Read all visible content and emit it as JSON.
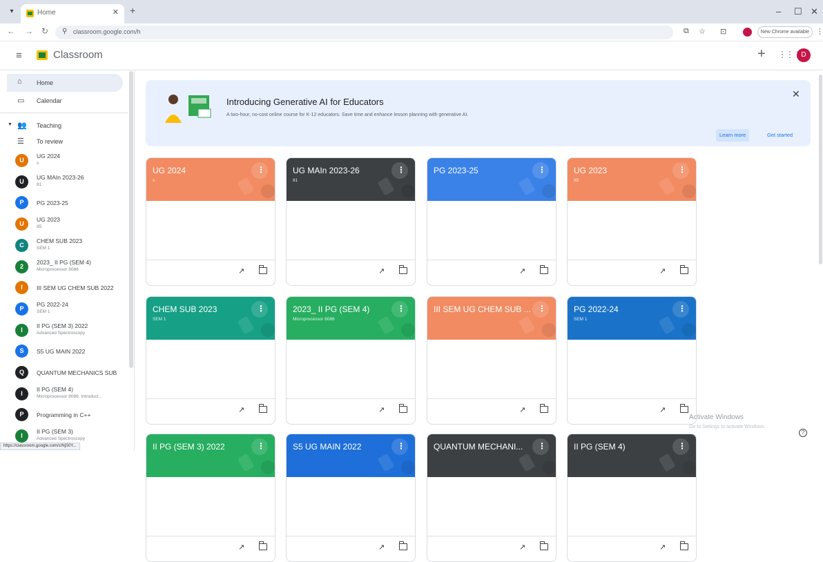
{
  "browser": {
    "tab_title": "Home",
    "url": "classroom.google.com/h",
    "new_chrome": "New Chrome available",
    "status_url": "https://classroom.google.com/c/NjS0Y..."
  },
  "app": {
    "name": "Classroom",
    "user_initial": "D"
  },
  "sidebar": {
    "home": "Home",
    "calendar": "Calendar",
    "teaching": "Teaching",
    "to_review": "To review",
    "courses": [
      {
        "initial": "U",
        "name": "UG 2024",
        "sub": "s",
        "color": "#e37400"
      },
      {
        "initial": "U",
        "name": "UG MAIn 2023-26",
        "sub": "81",
        "color": "#202124"
      },
      {
        "initial": "P",
        "name": "PG 2023-25",
        "sub": "",
        "color": "#1a73e8"
      },
      {
        "initial": "U",
        "name": "UG 2023",
        "sub": "85",
        "color": "#e37400"
      },
      {
        "initial": "C",
        "name": "CHEM SUB 2023",
        "sub": "SEM 1",
        "color": "#12837e"
      },
      {
        "initial": "2",
        "name": "2023_ II PG (SEM 4)",
        "sub": "Microprocessor 8086",
        "color": "#188038"
      },
      {
        "initial": "I",
        "name": "III SEM UG CHEM SUB 2022",
        "sub": "",
        "color": "#e37400"
      },
      {
        "initial": "P",
        "name": "PG 2022-24",
        "sub": "SEM 1",
        "color": "#1a73e8"
      },
      {
        "initial": "I",
        "name": "II PG (SEM 3) 2022",
        "sub": "Advanced Spectroscopy",
        "color": "#188038"
      },
      {
        "initial": "S",
        "name": "S5 UG MAIN 2022",
        "sub": "",
        "color": "#1a73e8"
      },
      {
        "initial": "Q",
        "name": "QUANTUM MECHANICS SUB",
        "sub": "",
        "color": "#202124"
      },
      {
        "initial": "I",
        "name": "II PG (SEM 4)",
        "sub": "Microprocessor 8086: Introduct...",
        "color": "#202124"
      },
      {
        "initial": "P",
        "name": "Programming in C++",
        "sub": "",
        "color": "#202124"
      },
      {
        "initial": "I",
        "name": "II PG (SEM 3)",
        "sub": "Advanced Spectroscopy",
        "color": "#188038"
      }
    ]
  },
  "banner": {
    "title": "Introducing Generative AI for Educators",
    "description": "A two-hour, no-cost online course for K-12 educators. Save time and enhance lesson planning with generative AI.",
    "learn_more": "Learn more",
    "get_started": "Get started"
  },
  "cards": [
    {
      "title": "UG 2024",
      "sub": "s",
      "color": "#f28b62"
    },
    {
      "title": "UG MAIn 2023-26",
      "sub": "81",
      "color": "#3c4043"
    },
    {
      "title": "PG 2023-25",
      "sub": "",
      "color": "#3b82e8"
    },
    {
      "title": "UG 2023",
      "sub": "85",
      "color": "#f28b62"
    },
    {
      "title": "CHEM SUB 2023",
      "sub": "SEM 1",
      "color": "#16a085"
    },
    {
      "title": "2023_ II PG (SEM 4)",
      "sub": "Microprocessor 8086",
      "color": "#27ae60"
    },
    {
      "title": "III SEM UG CHEM SUB ...",
      "sub": "",
      "color": "#f28b62"
    },
    {
      "title": "PG 2022-24",
      "sub": "SEM 1",
      "color": "#1a73c8"
    },
    {
      "title": "II PG (SEM 3) 2022",
      "sub": "",
      "color": "#27ae60"
    },
    {
      "title": "S5 UG MAIN 2022",
      "sub": "",
      "color": "#1e6fd9"
    },
    {
      "title": "QUANTUM MECHANI...",
      "sub": "",
      "color": "#3c4043"
    },
    {
      "title": "II PG (SEM 4)",
      "sub": "",
      "color": "#3c4043"
    }
  ],
  "watermark": {
    "title": "Activate Windows",
    "sub": "Go to Settings to activate Windows."
  }
}
